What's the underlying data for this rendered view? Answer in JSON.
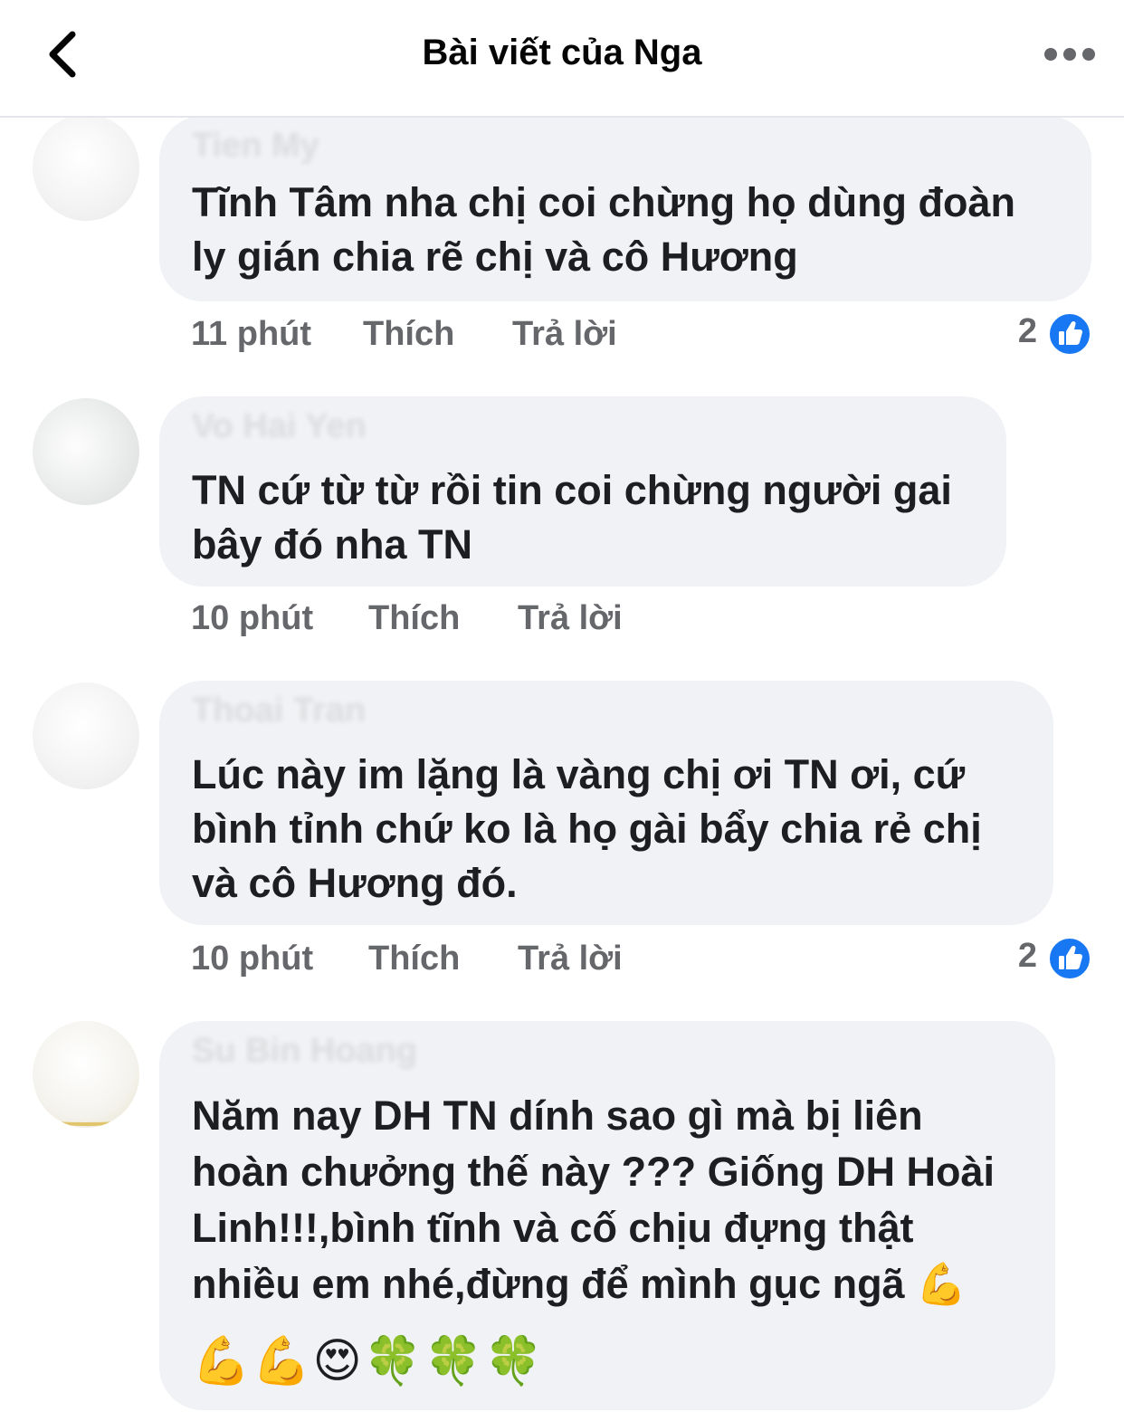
{
  "header": {
    "title": "Bài viết của Nga"
  },
  "comments": [
    {
      "author": "Tien My",
      "text": "Tĩnh Tâm nha chị coi chừng họ dùng đoàn\nly gián chia rẽ chị và cô Hương",
      "time": "11 phút",
      "like_label": "Thích",
      "reply_label": "Trả lời",
      "reactions": "2"
    },
    {
      "author": "Vo Hai Yen",
      "text": "TN cứ từ từ rồi tin coi chừng người gai\nbây đó nha TN",
      "time": "10 phút",
      "like_label": "Thích",
      "reply_label": "Trả lời"
    },
    {
      "author": "Thoai Tran",
      "text": "Lúc này im lặng là vàng chị  ơi TN ơi, cứ\nbình tỉnh chứ ko là họ gài bẩy chia rẻ chị\nvà cô Hương đó.",
      "time": "10 phút",
      "like_label": "Thích",
      "reply_label": "Trả lời",
      "reactions": "2"
    },
    {
      "author": "Su Bin Hoang",
      "text": "Năm nay DH TN dính sao gì mà bị liên\nhoàn chưởng thế này ??? Giống DH Hoài\nLinh!!!,bình tĩnh và cố chịu đựng thật\nnhiều em nhé,đừng để mình gục ngã",
      "emoji_inline": "💪",
      "emoji_line": "💪💪😍🍀🍀🍀"
    }
  ],
  "icons": {
    "back": "chevron-left-icon",
    "more": "more-horizontal-icon",
    "like": "thumbs-up-reaction-icon"
  },
  "colors": {
    "bubble": "#f0f2f5",
    "like_blue": "#1877f2",
    "meta_gray": "#65676b",
    "text": "#1c1e21"
  }
}
